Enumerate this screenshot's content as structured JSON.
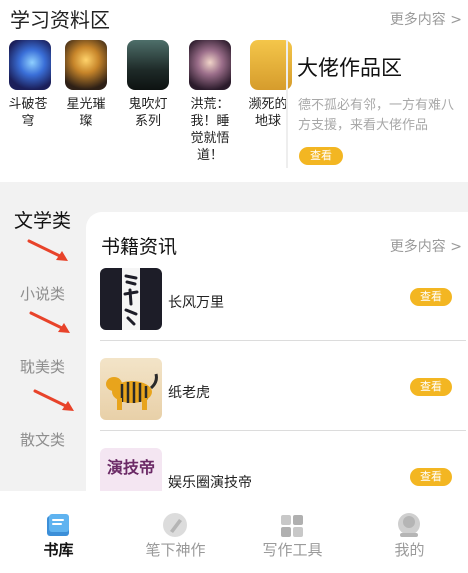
{
  "study": {
    "title": "学习资料区",
    "more": "更多内容 >",
    "books": [
      {
        "name": "斗破苍穹"
      },
      {
        "name": "星光璀璨"
      },
      {
        "name": "鬼吹灯系列"
      },
      {
        "name": "洪荒：我！睡觉就悟道！"
      },
      {
        "name": "濒死的地球"
      }
    ]
  },
  "featured": {
    "title": "大佬作品区",
    "desc": "德不孤必有邻，一方有难八方支援，来看大佬作品",
    "button": "查看"
  },
  "literature": {
    "title": "文学类",
    "categories": [
      "小说类",
      "耽美类",
      "散文类"
    ]
  },
  "news": {
    "title": "书籍资讯",
    "more": "更多内容 >",
    "items": [
      {
        "name": "长风万里",
        "button": "查看"
      },
      {
        "name": "纸老虎",
        "button": "查看"
      },
      {
        "name": "娱乐圈演技帝",
        "button": "查看"
      }
    ],
    "thumb3_text": "演技帝"
  },
  "tabbar": {
    "tabs": [
      {
        "label": "书库",
        "icon": "book-icon",
        "active": true
      },
      {
        "label": "笔下神作",
        "icon": "pen-icon",
        "active": false
      },
      {
        "label": "写作工具",
        "icon": "tools-icon",
        "active": false
      },
      {
        "label": "我的",
        "icon": "profile-icon",
        "active": false
      }
    ]
  },
  "colors": {
    "accent": "#f3b622",
    "arrow": "#e8432a",
    "grey_text": "#9a9a9a"
  }
}
